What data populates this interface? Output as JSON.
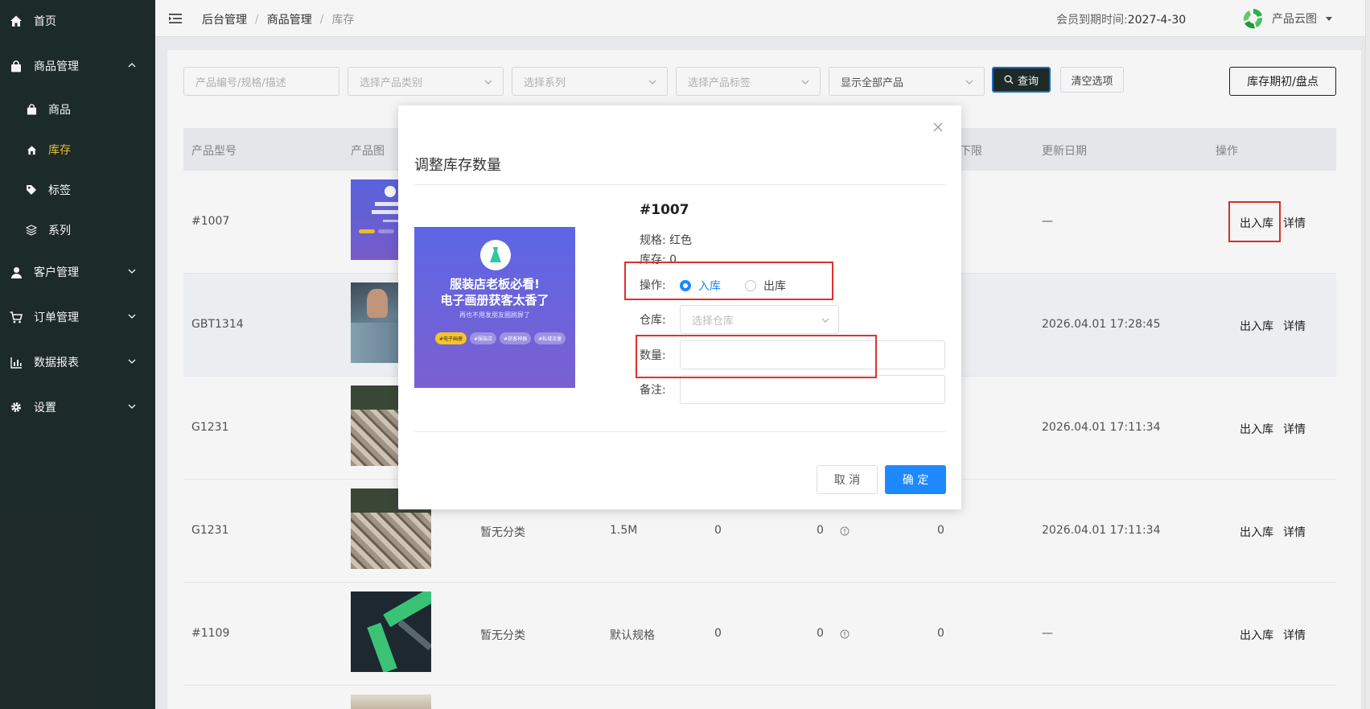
{
  "sidebar": {
    "items": [
      {
        "label": "首页",
        "icon": "home-icon"
      },
      {
        "label": "商品管理",
        "icon": "bag-icon"
      },
      {
        "label": "商品",
        "icon": "bag-icon"
      },
      {
        "label": "库存",
        "icon": "house-icon"
      },
      {
        "label": "标签",
        "icon": "tag-icon"
      },
      {
        "label": "系列",
        "icon": "layers-icon"
      },
      {
        "label": "客户管理",
        "icon": "user-icon"
      },
      {
        "label": "订单管理",
        "icon": "cart-icon"
      },
      {
        "label": "数据报表",
        "icon": "chart-icon"
      },
      {
        "label": "设置",
        "icon": "gear-icon"
      }
    ],
    "active_color": "#f5c13b",
    "bg_color": "#1f2d2a"
  },
  "header": {
    "breadcrumb": [
      "后台管理",
      "商品管理",
      "库存"
    ],
    "member_label": "会员到期时间:",
    "member_value": "2027-4-30",
    "brand": "产品云图"
  },
  "filters": {
    "search_placeholder": "产品编号/规格/描述",
    "category_placeholder": "选择产品类别",
    "series_placeholder": "选择系列",
    "tag_placeholder": "选择产品标签",
    "display_value": "显示全部产品",
    "query_label": "查询",
    "clear_label": "清空选项",
    "stock_label": "库存期初/盘点"
  },
  "table": {
    "headers": [
      "产品型号",
      "产品图",
      "下限",
      "更新日期",
      "操作"
    ],
    "op_inout": "出入库",
    "op_detail": "详情",
    "rows": [
      {
        "code": "#1007",
        "category": "",
        "spec": "",
        "a": "",
        "b": "",
        "c": "",
        "date": "—"
      },
      {
        "code": "GBT1314",
        "category": "",
        "spec": "",
        "a": "",
        "b": "",
        "c": "",
        "date": "2026.04.01 17:28:45"
      },
      {
        "code": "G1231",
        "category": "",
        "spec": "",
        "a": "",
        "b": "",
        "c": "",
        "date": "2026.04.01 17:11:34"
      },
      {
        "code": "G1231",
        "category": "暂无分类",
        "spec": "1.5M",
        "a": "0",
        "b": "0",
        "c": "0",
        "date": "2026.04.01 17:11:34"
      },
      {
        "code": "#1109",
        "category": "暂无分类",
        "spec": "默认规格",
        "a": "0",
        "b": "0",
        "c": "0",
        "date": "—"
      }
    ]
  },
  "dialog": {
    "title": "调整库存数量",
    "product_code": "#1007",
    "spec_label": "规格:",
    "spec_value": "红色",
    "stock_label": "库存:",
    "stock_value": "0",
    "operation_label": "操作:",
    "radio_in": "入库",
    "radio_out": "出库",
    "warehouse_label": "仓库:",
    "warehouse_placeholder": "选择仓库",
    "quantity_label": "数量:",
    "quantity_value": "",
    "remark_label": "备注:",
    "remark_value": "",
    "cancel_label": "取 消",
    "confirm_label": "确 定",
    "image": {
      "line1": "服装店老板必看!",
      "line2": "电子画册获客太香了",
      "subline": "再也不用发朋友圈刷屏了",
      "tags": [
        "#电子画册",
        "#服装店",
        "#获客神器",
        "#私域流量"
      ]
    },
    "accent_color": "#1e88ff"
  },
  "highlight_color": "#e0302f"
}
